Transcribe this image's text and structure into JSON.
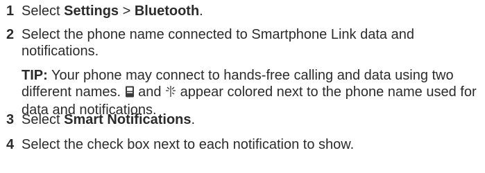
{
  "steps": [
    {
      "number": "1",
      "parts": [
        "Select ",
        "Settings",
        " > ",
        "Bluetooth",
        "."
      ]
    },
    {
      "number": "2",
      "text": "Select the phone name connected to Smartphone Link data and notifications."
    },
    {
      "number": "3",
      "parts": [
        "Select ",
        "Smart Notifications",
        "."
      ]
    },
    {
      "number": "4",
      "text": "Select the check box next to each notification to show."
    }
  ],
  "tip": {
    "label": "TIP:",
    "text_before_icons": " Your phone may connect to hands-free calling and data using two different names. ",
    "icon1": "phone-data-icon",
    "between_icons": " and ",
    "icon2": "notification-icon",
    "text_after_icons": " appear colored next to the phone name used for data and notifications."
  },
  "colors": {
    "text": "#2b2b2b",
    "background": "#ffffff"
  }
}
